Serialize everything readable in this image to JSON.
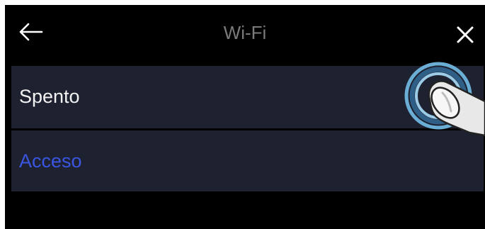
{
  "header": {
    "title": "Wi-Fi",
    "back_icon": "arrow-left-icon",
    "close_icon": "close-icon"
  },
  "options": [
    {
      "label": "Spento",
      "selected": false
    },
    {
      "label": "Acceso",
      "selected": true
    }
  ],
  "touch_hint_icon": "finger-tap-icon",
  "colors": {
    "background": "#000000",
    "row_background": "#1e2230",
    "selected_text": "#3a56e0",
    "default_text": "#f2f2f2",
    "title_text": "#7a7a7a",
    "tap_ring": "#6aaed6"
  }
}
